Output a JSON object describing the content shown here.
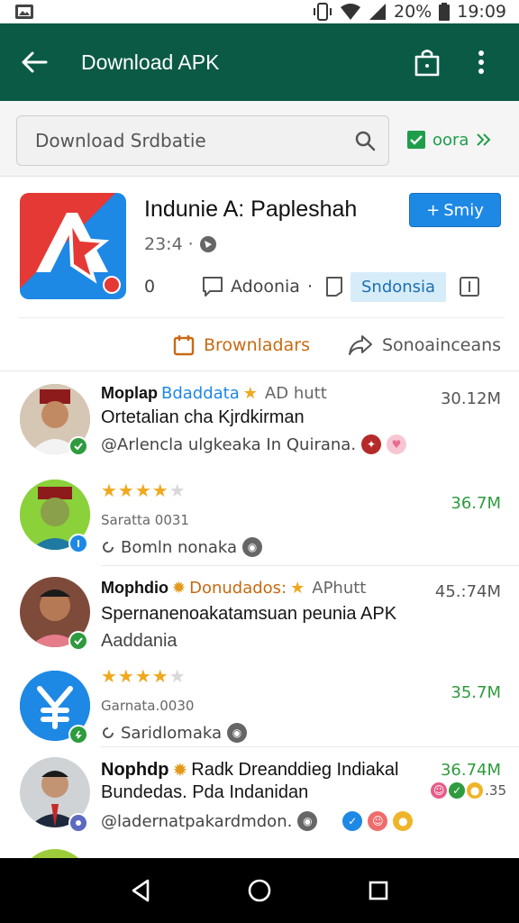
{
  "status_bar": {
    "battery": "20%",
    "time": "19:09"
  },
  "app_bar": {
    "title": "Download APK"
  },
  "search": {
    "placeholder": "Download Srdbatie"
  },
  "filter": {
    "label": "oora"
  },
  "app": {
    "title": "Indunie A: Papleshah",
    "rating": "23:4",
    "install_button": "Smiy",
    "downloads": "0",
    "publisher": "Adoonia",
    "region_chip": "Sndonsia",
    "tabs": {
      "downloaders": "Brownladars",
      "share": "Sonoainceans"
    }
  },
  "items": [
    {
      "name": "Moplap",
      "highlight": "Bdaddata",
      "tag": "AD hutt",
      "line2": "Ortetalian cha Kjrdkirman",
      "line3": "@Arlencla ulgkeaka In Quirana.",
      "value": "30.12M"
    },
    {
      "stars": 4,
      "small": "Saratta 0031",
      "line3": "Bomln nonaka",
      "value": "36.7M"
    },
    {
      "name": "Mophdio",
      "highlight": "Donudados:",
      "tag": "APhutt",
      "line2": "Spernanenoakatamsuan peunia APK",
      "line3": "Aaddania",
      "value": "45.:74M"
    },
    {
      "stars": 4,
      "small": "Garnata.0030",
      "line3": "Saridlomaka",
      "value": "35.7M"
    },
    {
      "name": "Nophdp",
      "highlight": "Radk Dreanddieg Indiakal",
      "tag": "",
      "line2": "Bundedas. Pda Indanidan",
      "line3": "@ladernatpakardmdon.",
      "value": "36.74M",
      "value2": ".35"
    }
  ],
  "colors": {
    "appbar": "#0b5a45",
    "accent_blue": "#1e88e5",
    "accent_green": "#2e9b3e",
    "accent_orange": "#c76a12"
  },
  "nav": {
    "back": "back-icon",
    "home": "home-icon",
    "recents": "recents-icon"
  }
}
